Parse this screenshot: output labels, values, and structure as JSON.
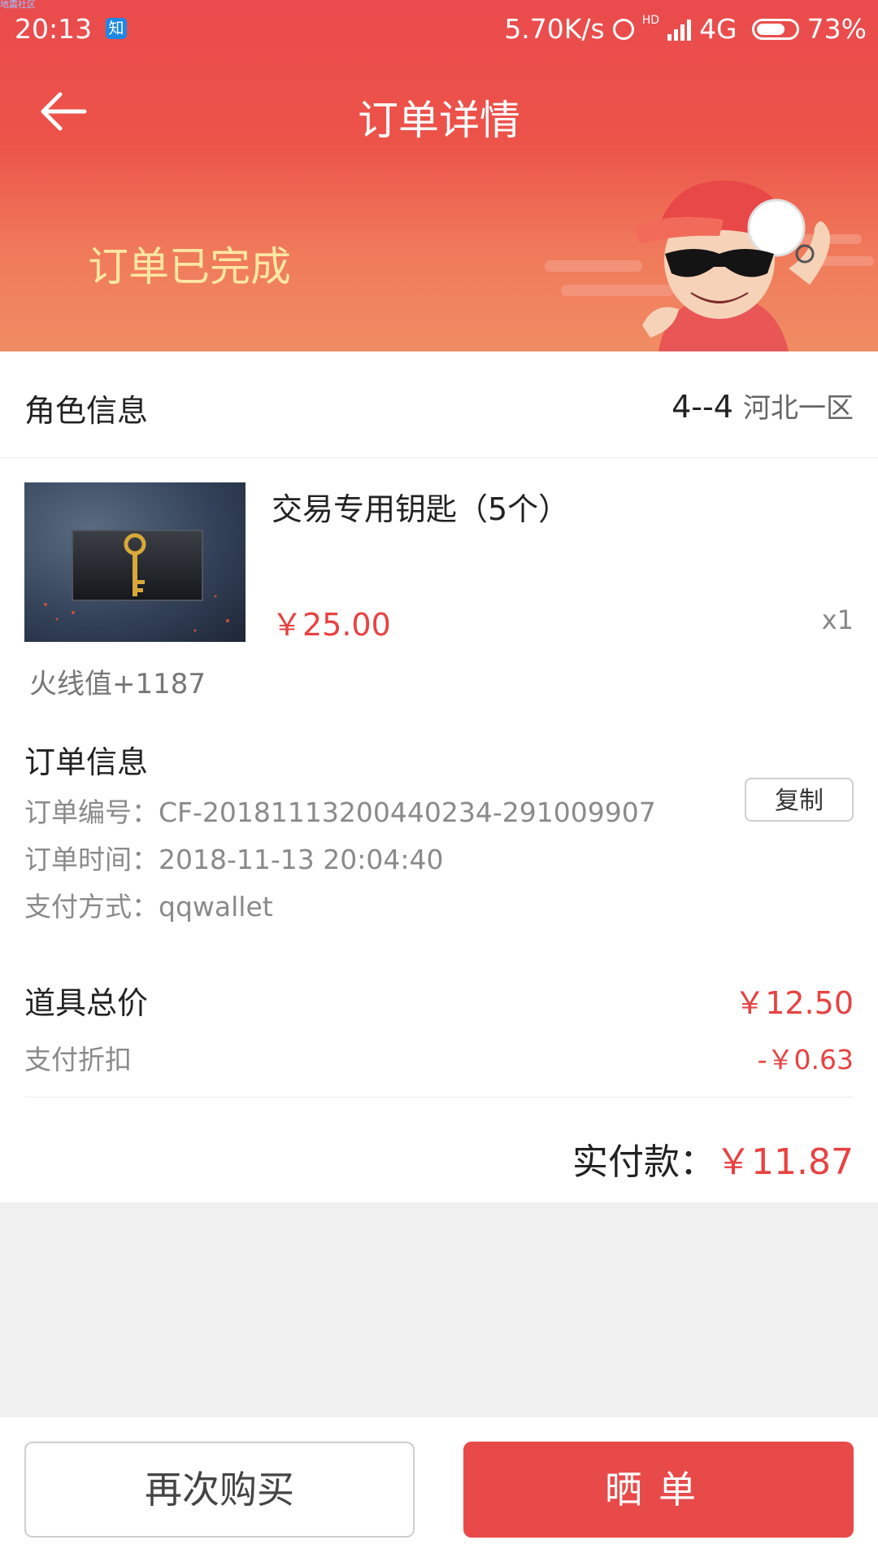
{
  "status_bar": {
    "carrier_tiny": "地震社区",
    "time": "20:13",
    "app_badge": "知",
    "net_speed": "5.70K/s",
    "hd": "HD",
    "network": "4G",
    "battery": "73%",
    "battery_level": 0.73
  },
  "nav": {
    "title": "订单详情"
  },
  "order": {
    "status": "订单已完成"
  },
  "role": {
    "label": "角色信息",
    "server_id": "4--4",
    "region": "河北一区"
  },
  "product": {
    "name": "交易专用钥匙（5个）",
    "price": "￥25.00",
    "quantity": "x1",
    "points": "火线值+1187"
  },
  "order_info": {
    "title": "订单信息",
    "number": "订单编号：CF-20181113200440234-291009907",
    "time": "订单时间：2018-11-13 20:04:40",
    "payment": "支付方式：qqwallet",
    "copy_label": "复制"
  },
  "pricing": {
    "subtotal_label": "道具总价",
    "subtotal": "￥12.50",
    "discount_label": "支付折扣",
    "discount": "-￥0.63",
    "total_label": "实付款：",
    "total": "￥11.87"
  },
  "actions": {
    "rebuy": "再次购买",
    "share": "晒单"
  },
  "colors": {
    "brand_red": "#e84a4a",
    "price_red": "#e84242",
    "status_gold": "#ffe7a3"
  }
}
